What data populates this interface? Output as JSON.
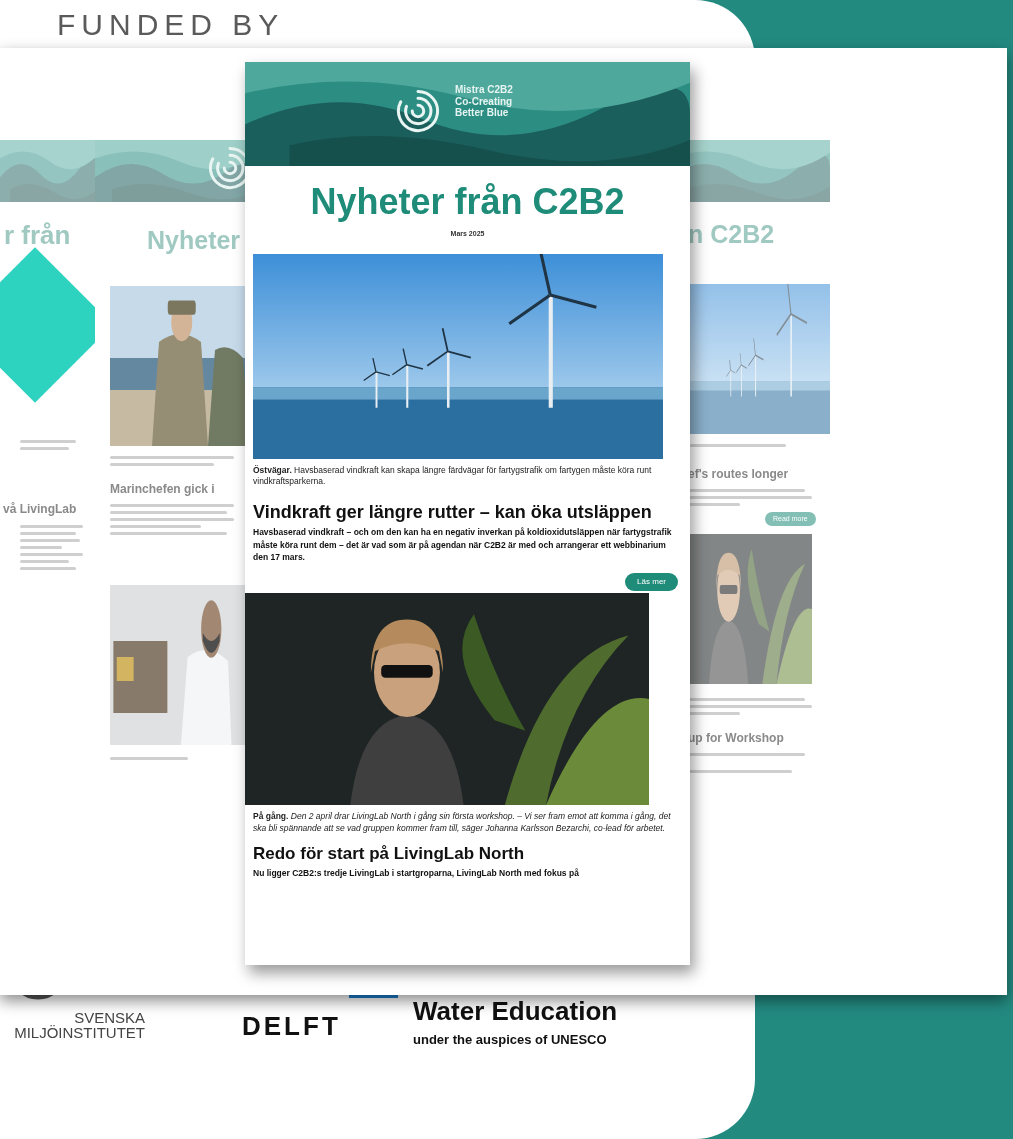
{
  "funded_by": "FUNDED BY",
  "mockup": {
    "left_page": {
      "title": "r från",
      "headline": "vå LivingLab"
    },
    "second_page": {
      "title": "Nyheter",
      "headline": "Marinchefen gick i"
    },
    "main_page": {
      "brand": [
        "Mistra C2B2",
        "Co-Creating",
        "Better Blue"
      ],
      "title": "Nyheter från C2B2",
      "date": "Mars 2025",
      "articles": [
        {
          "caption": "**Östvägar.** Havsbaserad vindkraft kan skapa längre färdvägar för fartygstrafik om fartygen måste köra runt vindkraftsparkerna.",
          "headline": "Vindkraft ger längre rutter – kan öka utsläppen",
          "body": "Havsbaserad vindkraft – och om den kan ha en negativ inverkan på koldioxidutsläppen när fartygstrafik måste köra runt dem – det är vad som är på agendan när C2B2 är med och arrangerar ett webbinarium den 17 mars.",
          "button": "Läs mer"
        },
        {
          "caption": "**På gång.** *Den 2 april drar LivingLab North i gång sin första workshop. – Vi ser fram emot att komma i gång, det ska bli spännande att se vad gruppen kommer fram till, säger Johanna Karlsson Bezarchi, co-lead för arbetet.*",
          "headline": "Redo för start på LivingLab North",
          "body": "Nu ligger C2B2:s tredje LivingLab i startgroparna, LivingLab North med fokus på"
        }
      ]
    },
    "right_page": {
      "title": "n C2B2",
      "headline": "ef's routes longer",
      "button": "Read more",
      "headline_2": "up for Workshop"
    }
  },
  "logos": {
    "svenska": "SVENSKA",
    "miljo": "MILJÖINSTITUTET",
    "delft": "DELFT",
    "water": "Water Education",
    "unesco": "under the auspices of UNESCO"
  }
}
